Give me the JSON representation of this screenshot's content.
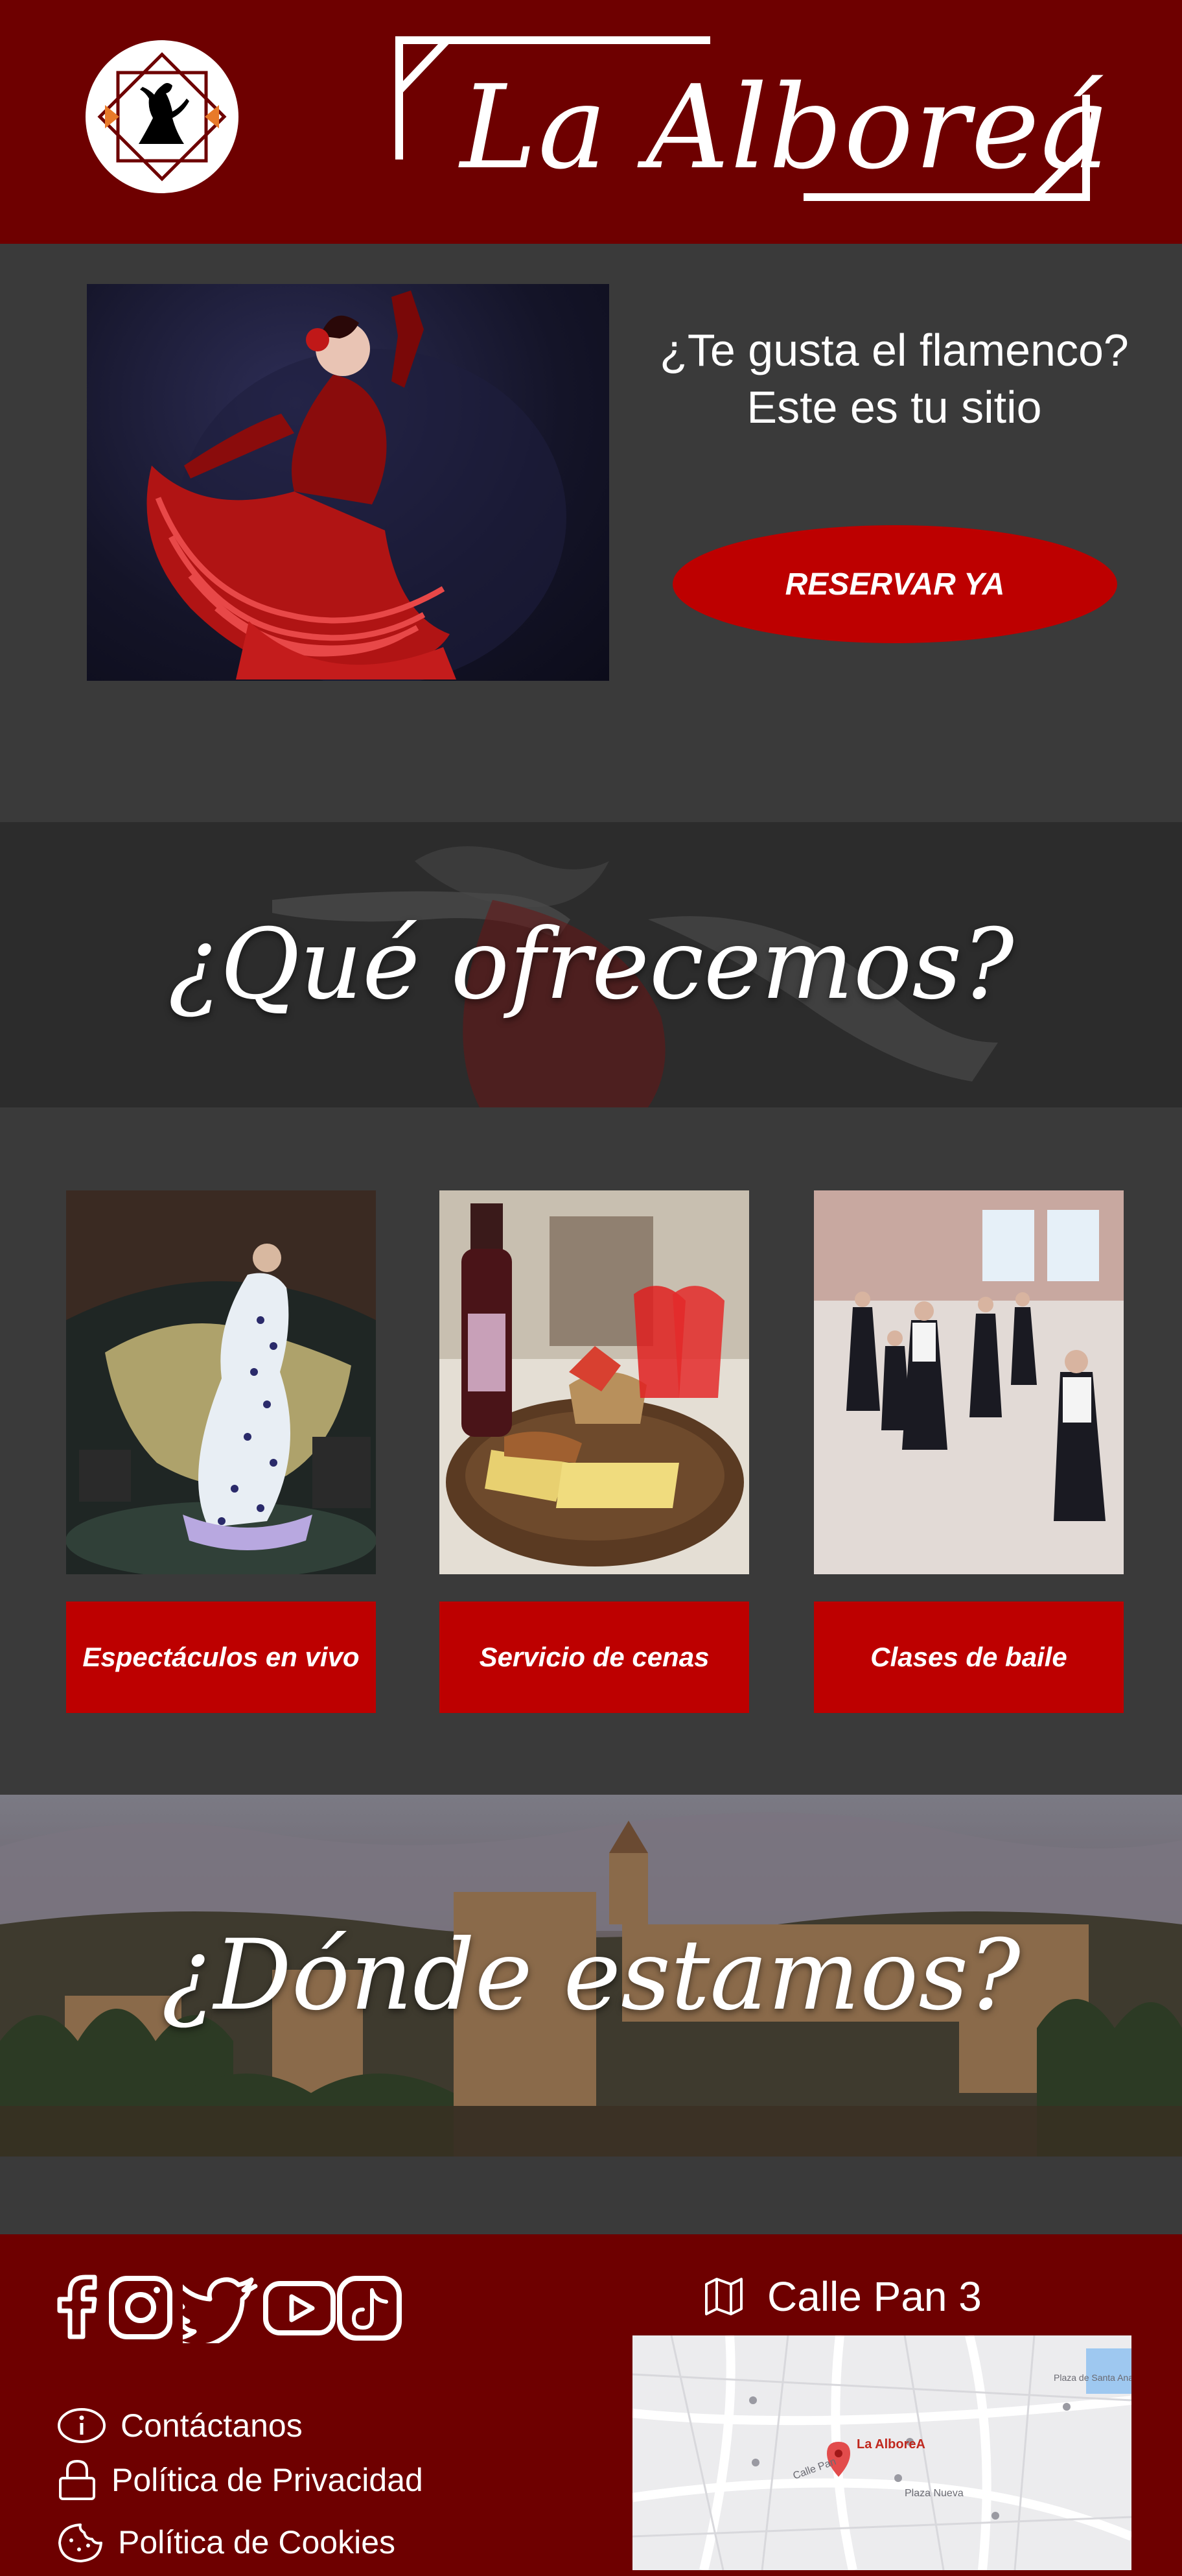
{
  "header": {
    "brand_name": "La Alboreá"
  },
  "hero": {
    "tagline_line1": "¿Te gusta el flamenco?",
    "tagline_line2": "Este es tu sitio",
    "cta_label": "RESERVAR YA"
  },
  "offer": {
    "heading": "¿Qué ofrecemos?",
    "cards": [
      {
        "label": "Espectáculos en vivo"
      },
      {
        "label": "Servicio de cenas"
      },
      {
        "label": "Clases de baile"
      }
    ]
  },
  "location": {
    "heading": "¿Dónde estamos?"
  },
  "footer": {
    "social": [
      "facebook-icon",
      "instagram-icon",
      "twitter-icon",
      "youtube-icon",
      "tiktok-icon"
    ],
    "links": {
      "contact": "Contáctanos",
      "privacy": "Política de Privacidad",
      "cookies": "Política de Cookies"
    },
    "address": "Calle Pan 3",
    "map": {
      "place_label": "La AlboreA",
      "streets": [
        "Plaza Nueva",
        "Calle Pan",
        "Plaza de Santa Ana"
      ]
    }
  },
  "colors": {
    "brand_dark_red": "#6e0000",
    "accent_red": "#bd0000",
    "background": "#3a3a3a"
  }
}
